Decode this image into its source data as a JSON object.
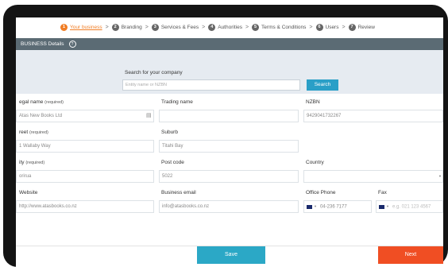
{
  "stepper": {
    "steps": [
      {
        "num": "1",
        "label": "Your business"
      },
      {
        "num": "2",
        "label": "Branding"
      },
      {
        "num": "3",
        "label": "Services & Fees"
      },
      {
        "num": "4",
        "label": "Authorities"
      },
      {
        "num": "5",
        "label": "Terms & Conditions"
      },
      {
        "num": "6",
        "label": "Users"
      },
      {
        "num": "7",
        "label": "Review"
      }
    ],
    "active_index": 0
  },
  "section": {
    "title": "BUSINESS Details",
    "info_glyph": "?"
  },
  "search": {
    "label": "Search for your company",
    "placeholder": "Entity name or NZBN",
    "button_label": "Search"
  },
  "form": {
    "legal_name": {
      "label": "egal name",
      "req": "(required)",
      "value": "Atas New Books Ltd"
    },
    "trading_name": {
      "label": "Trading name",
      "value": ""
    },
    "nzbn": {
      "label": "NZBN",
      "value": "9429041732267"
    },
    "street": {
      "label": "reet",
      "req": "(required)",
      "value": "1 Wallaby Way"
    },
    "suburb": {
      "label": "Suburb",
      "value": "Titahi Bay"
    },
    "city": {
      "label": "ity",
      "req": "(required)",
      "value": "orirua"
    },
    "post_code": {
      "label": "Post code",
      "value": "5022"
    },
    "country": {
      "label": "Country",
      "value": ""
    },
    "website": {
      "label": "Website",
      "value": "http://www.atasbooks.co.nz"
    },
    "business_email": {
      "label": "Business email",
      "value": "info@atasbooks.co.nz"
    },
    "office_phone": {
      "label": "Office Phone",
      "value": "04-236 7177"
    },
    "fax": {
      "label": "Fax",
      "placeholder": "e.g. 021 123 4567"
    }
  },
  "actions": {
    "save_label": "Save",
    "next_label": "Next"
  },
  "colors": {
    "accent_orange": "#f07d24",
    "save_button": "#2ba8c6",
    "next_button": "#f04e23",
    "section_bar": "#5b6b74",
    "search_panel": "#e6ebf1"
  }
}
